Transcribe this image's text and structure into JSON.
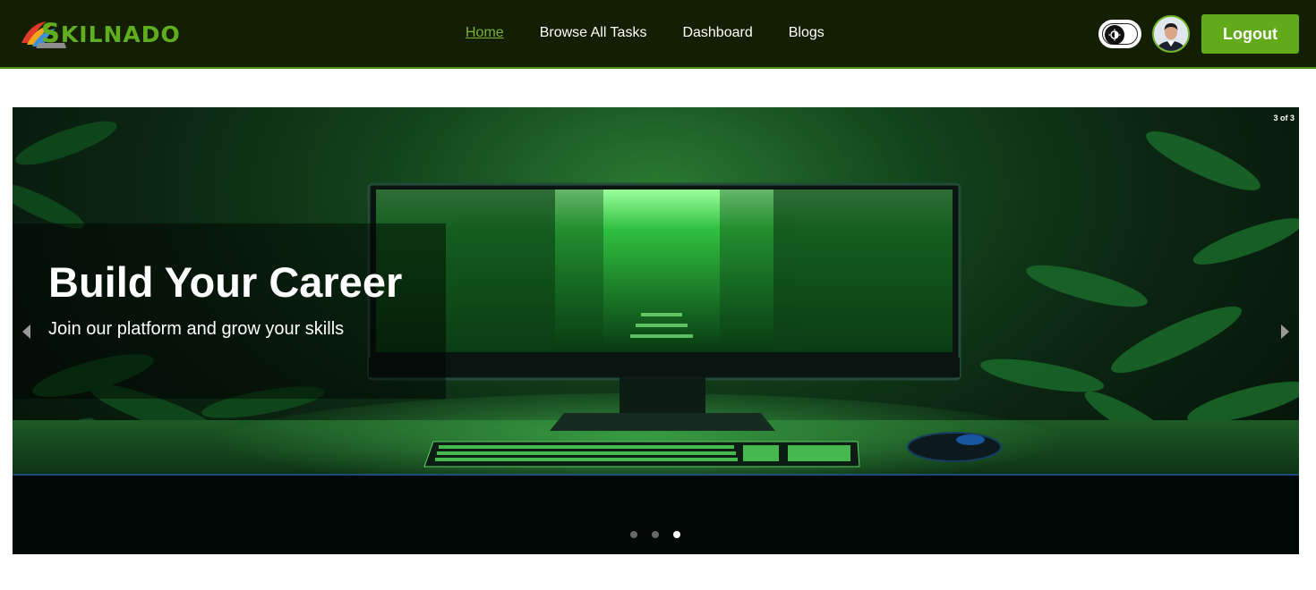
{
  "brand": {
    "logo_text_first": "S",
    "logo_text_rest": "KILNADO",
    "accent": "#62aa1a",
    "nav_bg": "#131e02"
  },
  "nav": {
    "links": [
      {
        "label": "Home",
        "active": true
      },
      {
        "label": "Browse All Tasks"
      },
      {
        "label": "Dashboard"
      },
      {
        "label": "Blogs"
      }
    ]
  },
  "header_actions": {
    "theme_toggle_icon": "sun-moon-icon",
    "avatar_icon": "user-avatar",
    "logout_label": "Logout"
  },
  "hero": {
    "slide_counter": "3 of 3",
    "title": "Build Your Career",
    "subtitle": "Join our platform and grow your skills",
    "current_slide": 3,
    "total_slides": 3,
    "prev_icon": "chevron-left-icon",
    "next_icon": "chevron-right-icon"
  }
}
